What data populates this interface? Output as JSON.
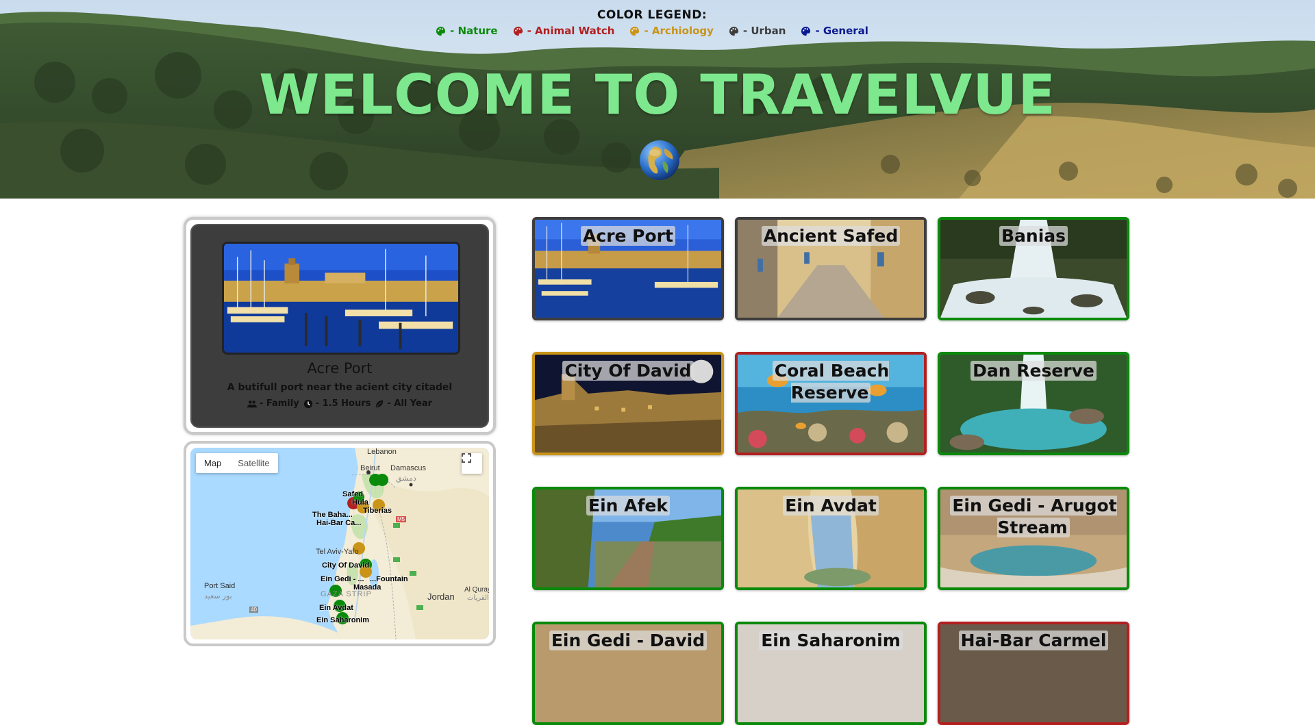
{
  "legend": {
    "title": "COLOR LEGEND:",
    "items": [
      {
        "label": "- Nature",
        "color": "#0a8a0a"
      },
      {
        "label": "- Animal Watch",
        "color": "#b21f1f"
      },
      {
        "label": "- Archiology",
        "color": "#c99418"
      },
      {
        "label": "- Urban",
        "color": "#3d3d3d"
      },
      {
        "label": "- General",
        "color": "#0b1a8f"
      }
    ]
  },
  "hero": {
    "title": "WELCOME TO TRAVELVUE",
    "title_color": "#7de88d",
    "icon": "globe-icon"
  },
  "detail": {
    "name": "Acre Port",
    "description": "A butifull port near the acient city citadel",
    "audience": "- Family",
    "duration": "- 1.5 Hours",
    "season": "- All Year",
    "icons": [
      "users-icon",
      "clock-icon",
      "leaf-icon"
    ]
  },
  "map": {
    "type_map": "Map",
    "type_satellite": "Satellite",
    "labels": {
      "lebanon": "Lebanon",
      "beirut": "Beirut",
      "damascus": "Damascus",
      "damascus_ar": "دمشق",
      "tel_aviv": "Tel Aviv-Yafo",
      "city_of_david": "City Of David",
      "ein_gedi": "Ein Gedi - ...",
      "masada": "Masada",
      "gaza": "GAZA STRIP",
      "port_said": "Port Said",
      "port_said_ar": "بور سعيد",
      "jordan": "Jordan",
      "al_qurayyat": "Al Qurayyat",
      "al_qurayyat_ar": "القريات",
      "ein_avdat": "Ein Avdat",
      "ein_saharonim": "Ein Saharonim",
      "the_baha": "The Baha...",
      "hai_bar": "Hai-Bar Ca...",
      "safed": "Safed",
      "hula": "Hula",
      "tiberias": "Tiberias",
      "route_40": "40",
      "route_5": "M5",
      "fountain": "...Fountain"
    },
    "pin_colors": [
      "#0a8a0a",
      "#b21f1f",
      "#c99418"
    ]
  },
  "cards": [
    {
      "title": "Acre Port",
      "category": "urban"
    },
    {
      "title": "Ancient Safed",
      "category": "urban"
    },
    {
      "title": "Banias",
      "category": "nature"
    },
    {
      "title": "City Of David",
      "category": "arch"
    },
    {
      "title": "Coral Beach Reserve",
      "category": "animal"
    },
    {
      "title": "Dan Reserve",
      "category": "nature"
    },
    {
      "title": "Ein Afek",
      "category": "nature"
    },
    {
      "title": "Ein Avdat",
      "category": "nature"
    },
    {
      "title": "Ein Gedi - Arugot Stream",
      "category": "nature"
    },
    {
      "title": "Ein Gedi - David",
      "category": "nature"
    },
    {
      "title": "Ein Saharonim",
      "category": "nature"
    },
    {
      "title": "Hai-Bar Carmel",
      "category": "animal"
    }
  ]
}
